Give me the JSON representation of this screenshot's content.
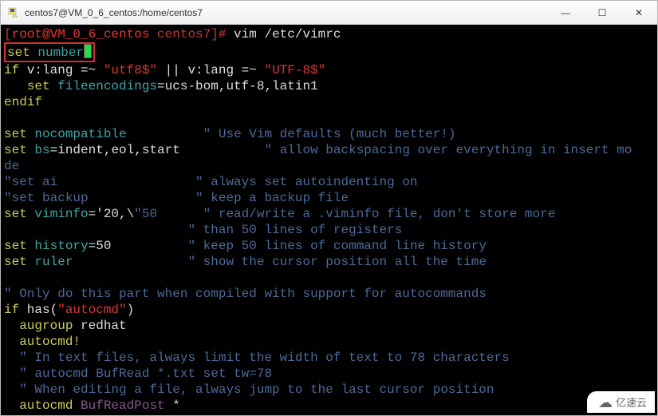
{
  "titlebar": {
    "title": "centos7@VM_0_6_centos:/home/centos7"
  },
  "winctl": {
    "min": "—",
    "max": "☐",
    "close": "✕"
  },
  "prompt": {
    "open": "[",
    "user": "root@VM_0_6_centos",
    "path": " centos7",
    "close": "]#",
    "cmd": " vim /etc/vimrc"
  },
  "l1": {
    "a": "set",
    "b": " number"
  },
  "l2": {
    "a": "if",
    "b": " v:lang =~ ",
    "c": "\"utf8$\"",
    "d": " || v:lang =~ ",
    "e": "\"UTF-8$\""
  },
  "l3": {
    "a": "   set",
    "b": " fileencodings",
    "c": "=ucs-bom,utf-8,latin1"
  },
  "l4": {
    "a": "endif"
  },
  "l5": {
    "a": "set",
    "b": " nocompatible",
    "pad": "          ",
    "c": "\" Use Vim defaults (much better!)"
  },
  "l6": {
    "a": "set",
    "b": " bs",
    "c": "=indent,eol,start",
    "pad": "           ",
    "d": "\" allow backspacing over everything in insert mo"
  },
  "l6b": {
    "a": "de"
  },
  "l7": {
    "a": "\"set ai                  \" always set autoindenting on"
  },
  "l8": {
    "a": "\"set backup              \" keep a backup file"
  },
  "l9": {
    "a": "set",
    "b": " viminfo",
    "c": "='20,\\",
    "d": "\"50      \" read/write a .viminfo file, don't store more"
  },
  "l10": {
    "a": "                        \" than 50 lines of registers"
  },
  "l11": {
    "a": "set",
    "b": " history",
    "c": "=50",
    "pad": "          ",
    "d": "\" keep 50 lines of command line history"
  },
  "l12": {
    "a": "set",
    "b": " ruler",
    "pad": "               ",
    "c": "\" show the cursor position all the time"
  },
  "l13": {
    "a": "\" Only do this part when compiled with support for autocommands"
  },
  "l14": {
    "a": "if",
    "b": " has(",
    "c": "\"autocmd\"",
    "d": ")"
  },
  "l15": {
    "a": "  augroup",
    "b": " redhat"
  },
  "l16": {
    "a": "  autocmd!"
  },
  "l17": {
    "a": "  \" In text files, always limit the width of text to 78 characters"
  },
  "l18": {
    "a": "  \" autocmd BufRead *.txt set tw=78"
  },
  "l19": {
    "a": "  \" When editing a file, always jump to the last cursor position"
  },
  "l20": {
    "a": "  autocmd",
    "b": " BufReadPost",
    "c": " *"
  },
  "watermark": {
    "text": "亿速云"
  }
}
